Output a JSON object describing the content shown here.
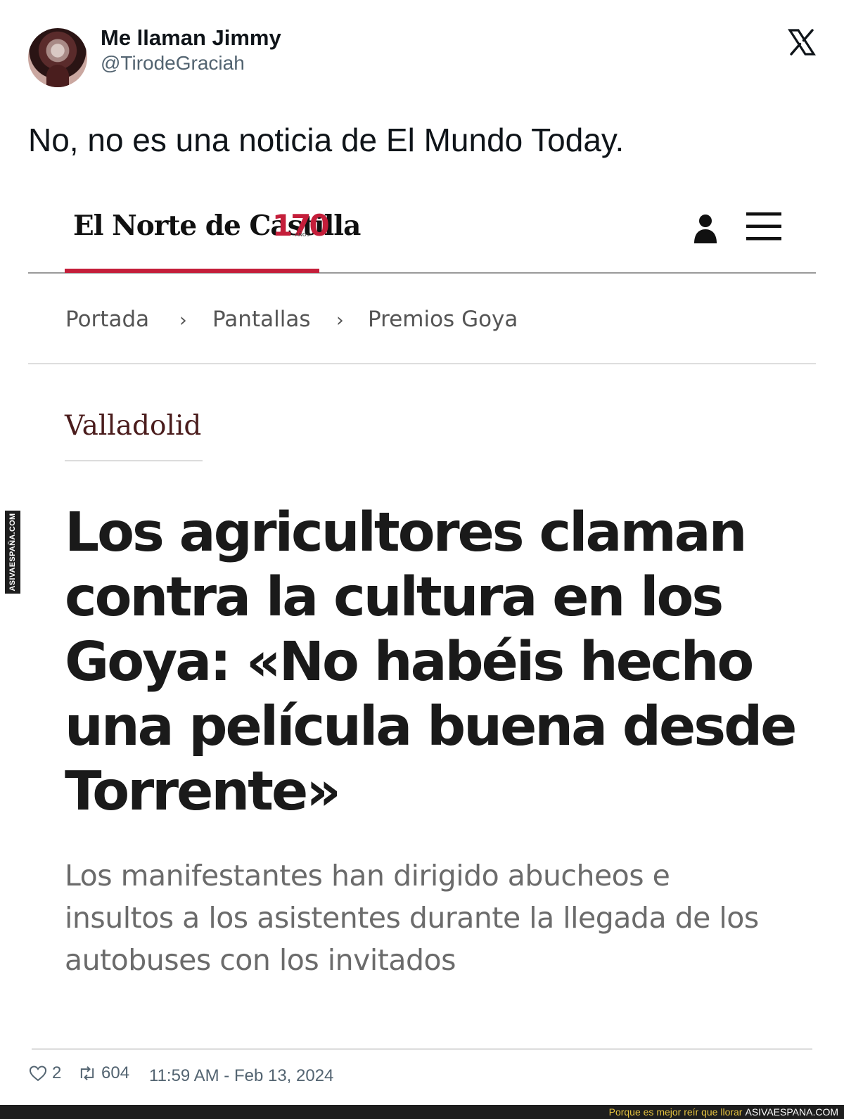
{
  "tweet": {
    "author_name": "Me llaman Jimmy",
    "author_handle": "@TirodeGraciah",
    "text": "No, no es una noticia de El Mundo Today.",
    "likes": "2",
    "retweets": "604",
    "timestamp": "11:59 AM - Feb 13, 2024"
  },
  "article": {
    "publication": "El Norte de Castilla",
    "anniversary": "170",
    "anniversary_sub": "AÑOS",
    "breadcrumbs": [
      "Portada",
      "Pantallas",
      "Premios Goya"
    ],
    "section": "Valladolid",
    "headline": "Los agricultores claman contra la cultura en los Goya: «No habéis hecho una película buena desde Torrente»",
    "subheadline": "Los manifestantes han dirigido abucheos e insultos a los asistentes durante la llegada de los autobuses con los invitados"
  },
  "watermark": {
    "side": "ASIVAESPAÑA.COM",
    "tagline": "Porque es mejor reír que llorar",
    "site": "ASIVAESPANA.COM"
  },
  "colors": {
    "accent_red": "#c41e3a",
    "section_color": "#4a1c1c",
    "watermark_yellow": "#e6c340"
  },
  "icons": [
    "x-logo-icon",
    "user-icon",
    "menu-icon",
    "heart-icon",
    "retweet-icon",
    "chevron-right-icon"
  ]
}
